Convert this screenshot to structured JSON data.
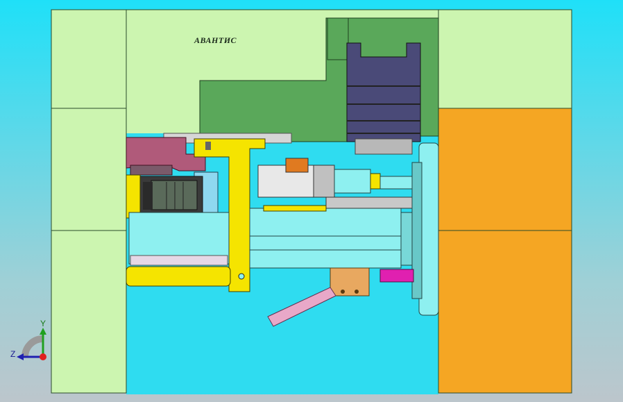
{
  "model": {
    "logo_text": "АВАНТИС"
  },
  "triad": {
    "y_label": "Y",
    "z_label": "Z"
  },
  "colors": {
    "background_top": "#1fe0f8",
    "frame_green": "#ccf5b0",
    "dark_green": "#5aa85a",
    "orange": "#f5a623",
    "yellow": "#f5e400",
    "cyan_part": "#8ef0f0",
    "navy": "#4a4a78",
    "magenta": "#e020b0",
    "pink_arm": "#e8a8c8",
    "maroon": "#b05a7a"
  }
}
